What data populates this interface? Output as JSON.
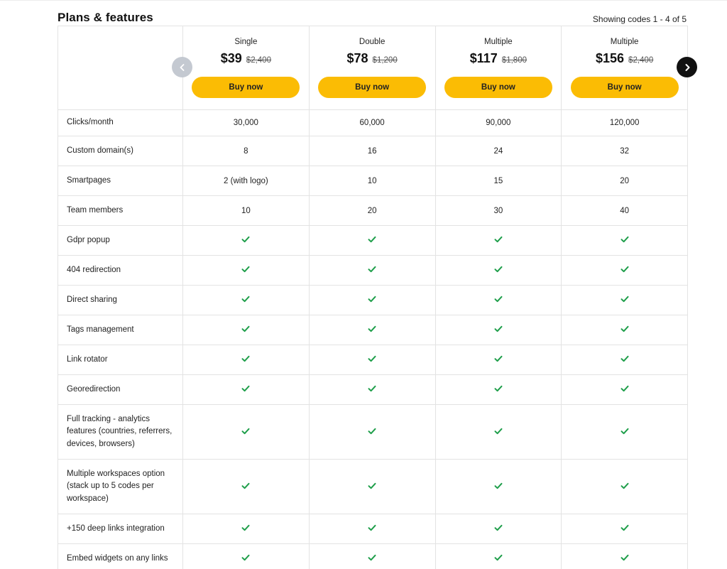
{
  "page": {
    "title": "Plans & features",
    "showing": "Showing codes 1 - 4 of 5"
  },
  "colors": {
    "accent": "#fbbc04",
    "check": "#1e9e4a",
    "nav_prev": "#c4c9d1",
    "nav_next": "#111111",
    "border": "#e3e3e3"
  },
  "nav": {
    "prev_icon": "chevron-left-icon",
    "next_icon": "chevron-right-icon"
  },
  "plans": [
    {
      "name": "Single",
      "price": "$39",
      "old_price": "$2,400",
      "buy_label": "Buy now"
    },
    {
      "name": "Double",
      "price": "$78",
      "old_price": "$1,200",
      "buy_label": "Buy now"
    },
    {
      "name": "Multiple",
      "price": "$117",
      "old_price": "$1,800",
      "buy_label": "Buy now"
    },
    {
      "name": "Multiple",
      "price": "$156",
      "old_price": "$2,400",
      "buy_label": "Buy now"
    }
  ],
  "features": [
    {
      "label": "Clicks/month",
      "values": [
        "30,000",
        "60,000",
        "90,000",
        "120,000"
      ]
    },
    {
      "label": "Custom domain(s)",
      "values": [
        "8",
        "16",
        "24",
        "32"
      ]
    },
    {
      "label": "Smartpages",
      "values": [
        "2 (with logo)",
        "10",
        "15",
        "20"
      ]
    },
    {
      "label": "Team members",
      "values": [
        "10",
        "20",
        "30",
        "40"
      ]
    },
    {
      "label": "Gdpr popup",
      "values": [
        "check",
        "check",
        "check",
        "check"
      ]
    },
    {
      "label": "404 redirection",
      "values": [
        "check",
        "check",
        "check",
        "check"
      ]
    },
    {
      "label": "Direct sharing",
      "values": [
        "check",
        "check",
        "check",
        "check"
      ]
    },
    {
      "label": "Tags management",
      "values": [
        "check",
        "check",
        "check",
        "check"
      ]
    },
    {
      "label": "Link rotator",
      "values": [
        "check",
        "check",
        "check",
        "check"
      ]
    },
    {
      "label": "Georedirection",
      "values": [
        "check",
        "check",
        "check",
        "check"
      ]
    },
    {
      "label": "Full tracking - analytics features (countries, referrers, devices, browsers)",
      "values": [
        "check",
        "check",
        "check",
        "check"
      ]
    },
    {
      "label": "Multiple workspaces option (stack up to 5 codes per workspace)",
      "values": [
        "check",
        "check",
        "check",
        "check"
      ]
    },
    {
      "label": "+150 deep links integration",
      "values": [
        "check",
        "check",
        "check",
        "check"
      ]
    },
    {
      "label": "Embed widgets on any links",
      "values": [
        "check",
        "check",
        "check",
        "check"
      ]
    }
  ]
}
